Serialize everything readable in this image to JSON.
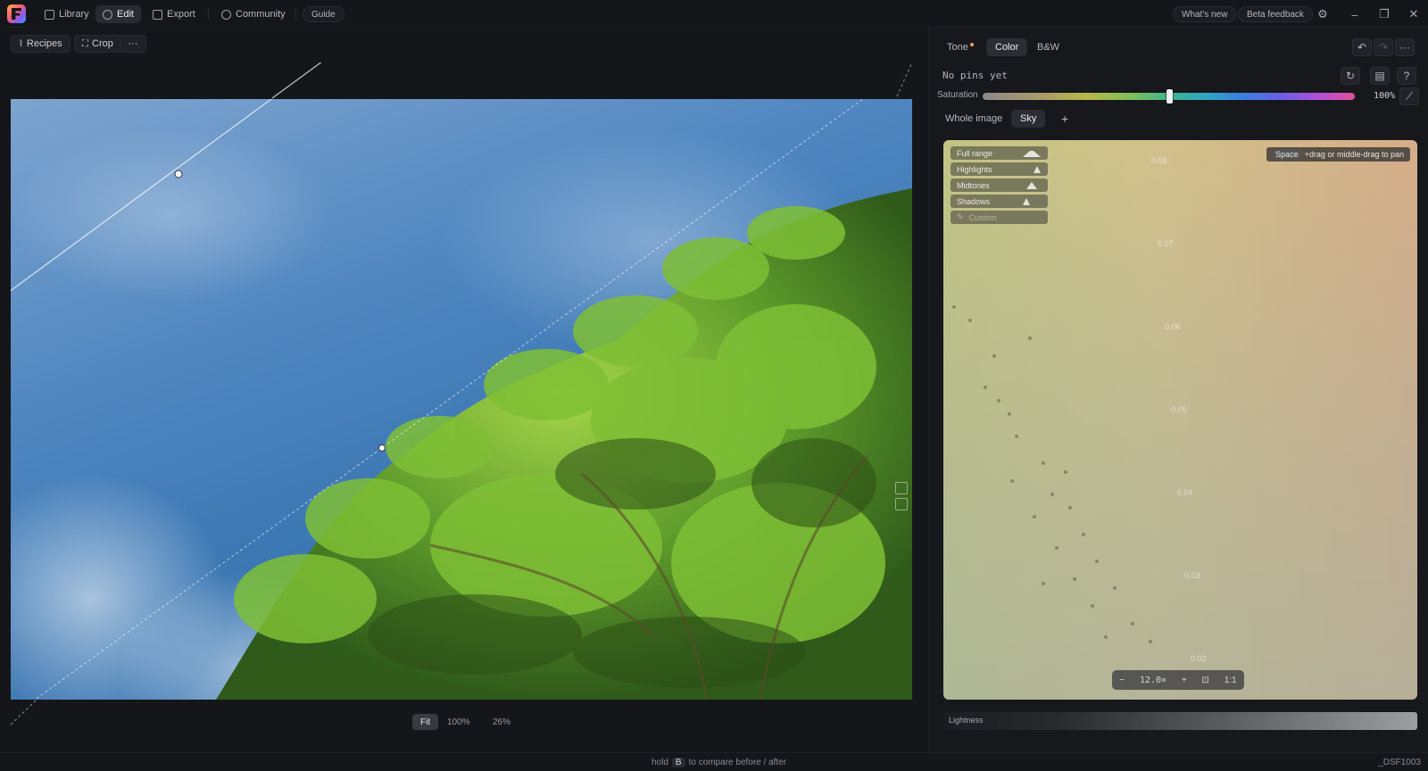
{
  "topbar": {
    "nav": [
      {
        "label": "Library",
        "icon": "library-icon"
      },
      {
        "label": "Edit",
        "icon": "palette-icon"
      },
      {
        "label": "Export",
        "icon": "export-icon"
      },
      {
        "label": "Community",
        "icon": "globe-icon"
      }
    ],
    "guide": "Guide",
    "whats_new": "What's new",
    "beta_feedback": "Beta feedback"
  },
  "toolbar": {
    "recipes": "Recipes",
    "crop": "Crop",
    "more": "···"
  },
  "zoom": {
    "fit": "Fit",
    "hundred": "100%",
    "current": "26%"
  },
  "status": {
    "hold": "hold",
    "key": "B",
    "compare": "to compare before / after",
    "filename": "_DSF1003"
  },
  "panel": {
    "tabs": [
      "Tone",
      "Color",
      "B&W"
    ],
    "active_tab": "Color",
    "no_pins": "No pins yet",
    "saturation_label": "Saturation",
    "saturation_value": "100%",
    "saturation_fraction": 0.5,
    "scopes": [
      "Whole image",
      "Sky"
    ],
    "add": "+",
    "ranges": [
      "Full range",
      "Highlights",
      "Midtones",
      "Shadows",
      "Custom"
    ],
    "hint_key": "Space",
    "hint_text": "+drag or middle-drag to pan",
    "ticks": [
      "0.08",
      "0.07",
      "0.06",
      "0.05",
      "0.04",
      "0.03",
      "0.02"
    ],
    "zoom_minus": "−",
    "zoom_value": "12.0×",
    "zoom_plus": "+",
    "zoom_one": "1:1",
    "lightness_label": "Lightness"
  },
  "colors": {
    "accent_dot": "#f39c4a",
    "background": "#15161a"
  }
}
